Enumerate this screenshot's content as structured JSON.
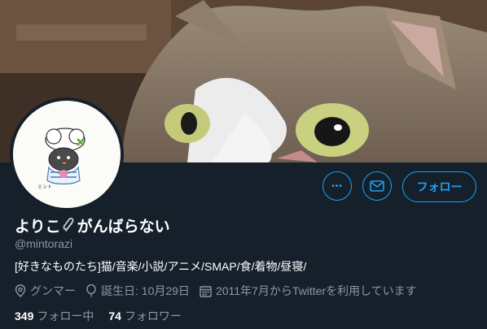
{
  "profile": {
    "display_name_prefix": "よりこ",
    "display_name_suffix": "がんばらない",
    "handle": "@mintorazi",
    "bio": "[好きなものたち]猫/音楽/小説/アニメ/SMAP/食/着物/昼寝/",
    "location": "グンマー",
    "birthday": "誕生日: 10月29日",
    "joined": "2011年7月からTwitterを利用しています"
  },
  "stats": {
    "following_count": "349",
    "following_label": "フォロー中",
    "followers_count": "74",
    "followers_label": "フォロワー"
  },
  "actions": {
    "more_label": "•••",
    "follow_label": "フォロー"
  },
  "icons": {
    "banner": "cat-photo",
    "avatar": "penguin-chef-drawing",
    "name_emoji": "paperclip-icon",
    "location": "location-pin-icon",
    "birthday": "balloon-icon",
    "joined": "calendar-icon",
    "message": "envelope-icon"
  },
  "colors": {
    "background": "#15202b",
    "accent": "#1da1f2",
    "muted_text": "#8899a6"
  }
}
